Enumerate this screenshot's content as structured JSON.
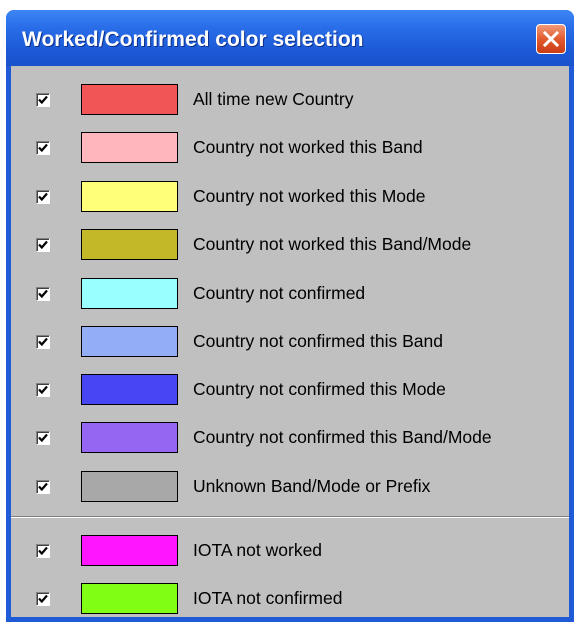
{
  "window": {
    "title": "Worked/Confirmed color selection"
  },
  "colors": {
    "titlebar": "#2a6ee9",
    "client_bg": "#c0c0c0",
    "close_button": "#e25a2f"
  },
  "group1": [
    {
      "label": "All time new Country",
      "color": "#f25555",
      "checked": true
    },
    {
      "label": "Country not worked this Band",
      "color": "#ffb6bc",
      "checked": true
    },
    {
      "label": "Country not worked this Mode",
      "color": "#ffff7a",
      "checked": true
    },
    {
      "label": "Country not worked this Band/Mode",
      "color": "#c3b828",
      "checked": true
    },
    {
      "label": "Country not confirmed",
      "color": "#9affff",
      "checked": true
    },
    {
      "label": "Country not confirmed this Band",
      "color": "#93aef5",
      "checked": true
    },
    {
      "label": "Country not confirmed this Mode",
      "color": "#4646f5",
      "checked": true
    },
    {
      "label": "Country not confirmed this Band/Mode",
      "color": "#9466f2",
      "checked": true
    },
    {
      "label": "Unknown Band/Mode or Prefix",
      "color": "#a8a8a8",
      "checked": true
    }
  ],
  "group2": [
    {
      "label": "IOTA not worked",
      "color": "#ff15ff",
      "checked": true
    },
    {
      "label": "IOTA not confirmed",
      "color": "#80ff14",
      "checked": true
    }
  ],
  "icons": {
    "close": "close-icon",
    "check": "checkmark-icon"
  }
}
